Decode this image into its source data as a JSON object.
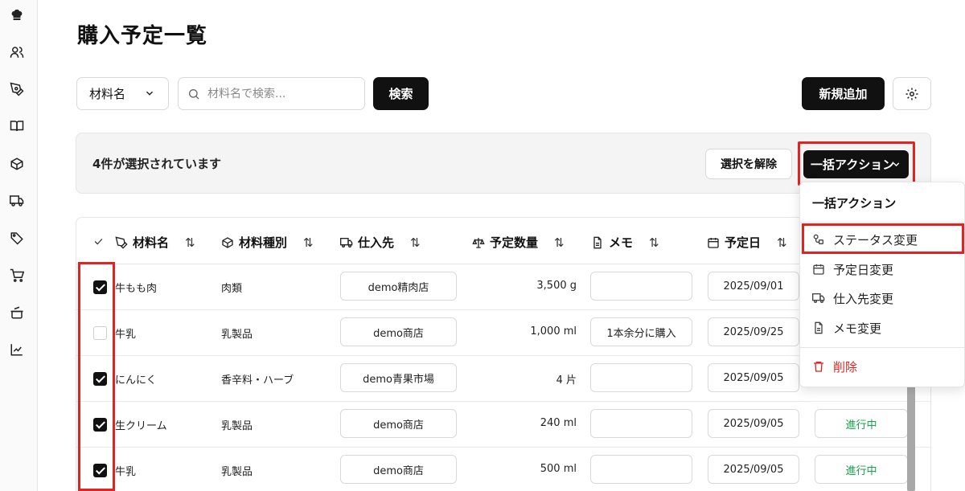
{
  "page": {
    "title": "購入予定一覧"
  },
  "sidebar": {
    "icons": [
      "chef-hat-icon",
      "users-icon",
      "pen-icon",
      "book-icon",
      "package-icon",
      "truck-icon",
      "tag-icon",
      "cart-icon",
      "pot-icon",
      "chart-icon"
    ]
  },
  "toolbar": {
    "field_select": "材料名",
    "search_placeholder": "材料名で検索...",
    "search_label": "検索",
    "new_label": "新規追加"
  },
  "selection": {
    "message": "4件が選択されています",
    "clear_label": "選択を解除",
    "bulk_label": "一括アクション"
  },
  "table": {
    "columns": {
      "name": "材料名",
      "type": "材料種別",
      "supplier": "仕入先",
      "qty": "予定数量",
      "memo": "メモ",
      "date": "予定日"
    },
    "rows": [
      {
        "checked": true,
        "name": "牛もも肉",
        "type": "肉類",
        "supplier": "demo精肉店",
        "qty": "3,500 g",
        "memo": "",
        "date": "2025/09/01",
        "status": ""
      },
      {
        "checked": false,
        "name": "牛乳",
        "type": "乳製品",
        "supplier": "demo商店",
        "qty": "1,000 ml",
        "memo": "1本余分に購入",
        "date": "2025/09/25",
        "status": ""
      },
      {
        "checked": true,
        "name": "にんにく",
        "type": "香辛料・ハーブ",
        "supplier": "demo青果市場",
        "qty": "4 片",
        "memo": "",
        "date": "2025/09/05",
        "status": ""
      },
      {
        "checked": true,
        "name": "生クリーム",
        "type": "乳製品",
        "supplier": "demo商店",
        "qty": "240 ml",
        "memo": "",
        "date": "2025/09/05",
        "status": "進行中"
      },
      {
        "checked": true,
        "name": "牛乳",
        "type": "乳製品",
        "supplier": "demo商店",
        "qty": "500 ml",
        "memo": "",
        "date": "2025/09/05",
        "status": "進行中"
      }
    ]
  },
  "dropdown": {
    "title": "一括アクション",
    "items": [
      {
        "label": "ステータス変更",
        "icon": "status-icon"
      },
      {
        "label": "予定日変更",
        "icon": "calendar-icon"
      },
      {
        "label": "仕入先変更",
        "icon": "truck-icon"
      },
      {
        "label": "メモ変更",
        "icon": "file-icon"
      },
      {
        "label": "削除",
        "icon": "trash-icon"
      }
    ]
  },
  "colors": {
    "accent_dark": "#111111",
    "highlight_red": "#e02424",
    "status_green": "#16a34a",
    "danger_red": "#dc2626"
  }
}
